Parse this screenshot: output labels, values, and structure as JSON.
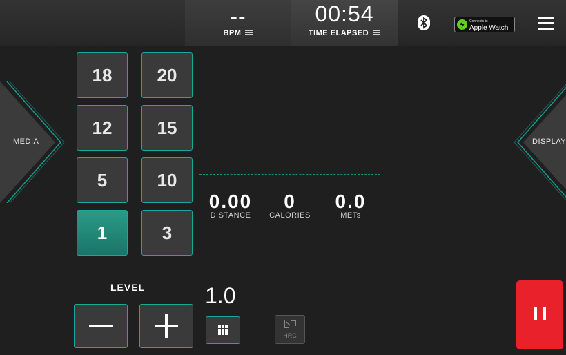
{
  "header": {
    "heart_rate": {
      "value": "--",
      "label": "BPM"
    },
    "time": {
      "value": "00:54",
      "label": "TIME ELAPSED"
    },
    "apple_watch": {
      "small_text": "Connects to",
      "name": "Apple Watch"
    },
    "bluetooth_icon": "bluetooth-icon",
    "menu_icon": "hamburger-menu-icon"
  },
  "side_tabs": {
    "left": "MEDIA",
    "right": "DISPLAY"
  },
  "levels": {
    "keys": [
      "18",
      "20",
      "12",
      "15",
      "5",
      "10",
      "1",
      "3"
    ],
    "active": "1",
    "label": "LEVEL",
    "current_value": "1.0"
  },
  "metrics": [
    {
      "value": "0.00",
      "label": "DISTANCE"
    },
    {
      "value": "0",
      "label": "CALORIES"
    },
    {
      "value": "0.0",
      "label": "METs"
    }
  ],
  "buttons": {
    "decrease_icon": "minus-icon",
    "increase_icon": "plus-icon",
    "keypad_icon": "keypad-grid-icon",
    "hrc_label": "HRC",
    "pause_icon": "pause-icon"
  },
  "colors": {
    "accent": "#1aa89a",
    "active_key": "#2c9a88",
    "pause": "#e8212b"
  }
}
